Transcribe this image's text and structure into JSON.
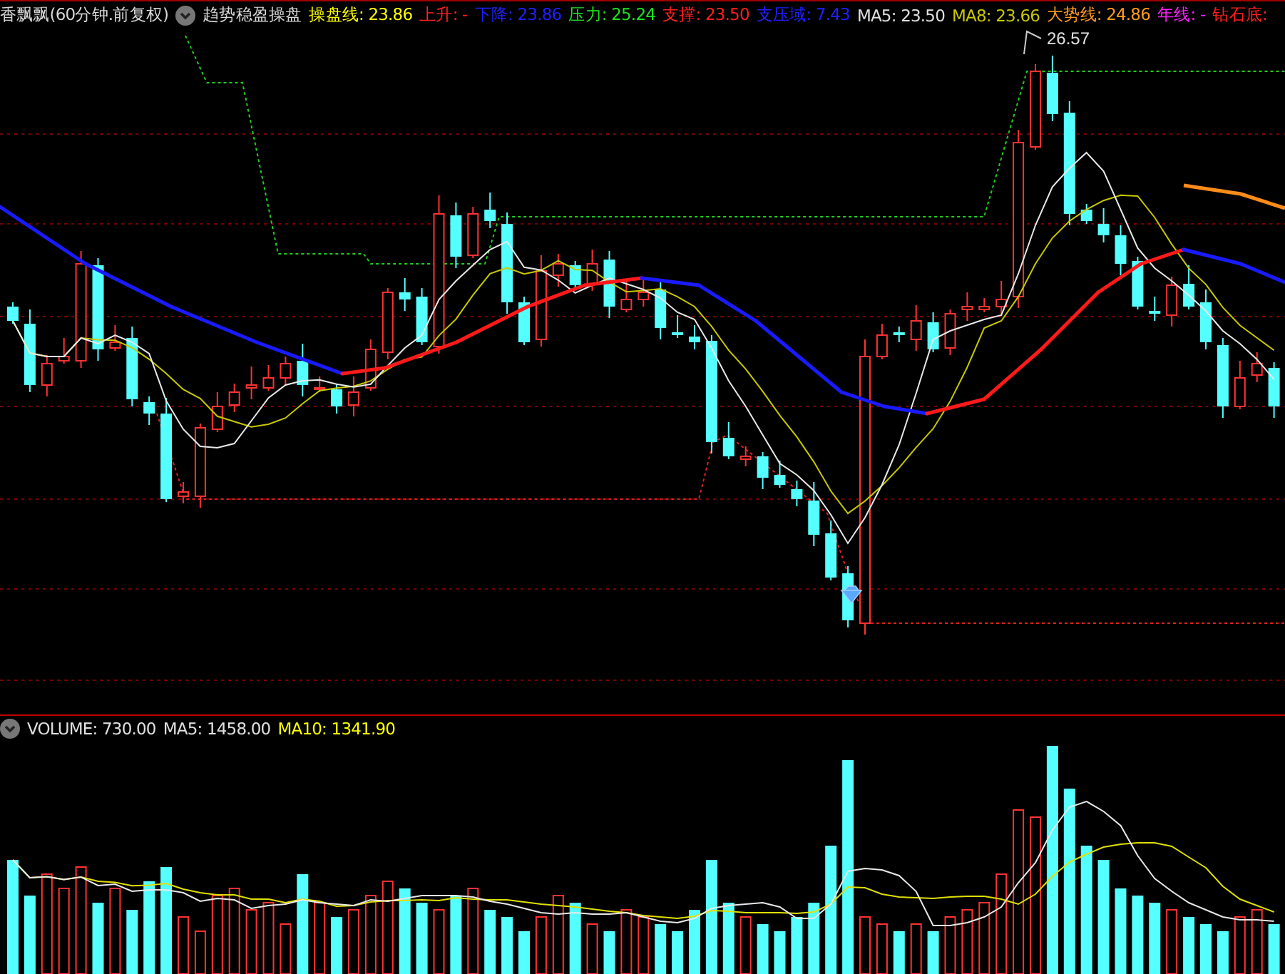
{
  "price_panel": {
    "title": "香飘飘(60分钟.前复权)",
    "indicator": "趋势稳盈操盘",
    "readouts": [
      {
        "text": "操盘线: 23.86",
        "color": "#ffff00"
      },
      {
        "text": "上升: -",
        "color": "#ff2020"
      },
      {
        "text": "下降: 23.86",
        "color": "#2020ff"
      },
      {
        "text": "压力: 25.24",
        "color": "#20e020"
      },
      {
        "text": "支撑: 23.50",
        "color": "#ff2020"
      },
      {
        "text": "支压域: 7.43",
        "color": "#2020ff"
      },
      {
        "text": "MA5: 23.50",
        "color": "#e0e0e0"
      },
      {
        "text": "MA8: 23.66",
        "color": "#c8c800"
      },
      {
        "text": "大势线: 24.86",
        "color": "#ff9a20"
      },
      {
        "text": "年线: -",
        "color": "#ff20ff"
      },
      {
        "text": "钻石底:",
        "color": "#ff2020"
      }
    ],
    "peak_label": "26.57"
  },
  "volume_panel": {
    "readouts": [
      {
        "text": "VOLUME: 730.00",
        "color": "#e0e0e0"
      },
      {
        "text": "MA5: 1458.00",
        "color": "#e0e0e0"
      },
      {
        "text": "MA10: 1341.90",
        "color": "#ffff00"
      }
    ]
  }
}
